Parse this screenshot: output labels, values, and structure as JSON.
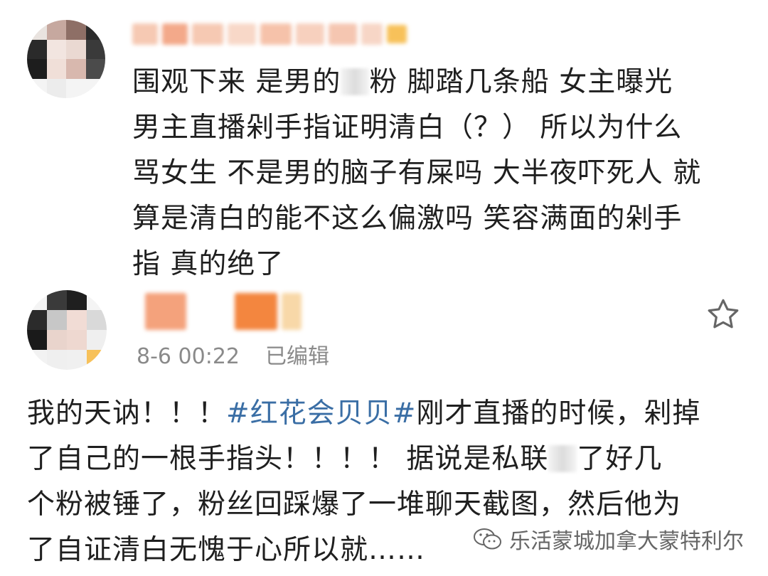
{
  "comments": [
    {
      "lines": [
        "围观下来 是男的",
        "粉 脚踏几条船 女主曝光",
        "男主直播剁手指证明清白（？） 所以为什么",
        "骂女生 不是男的脑子有屎吗 大半夜吓死人 就",
        "算是清白的能不这么偏激吗 笑容满面的剁手",
        "指 真的绝了"
      ]
    },
    {
      "timestamp": "8-6 00:22",
      "edited": "已编辑",
      "star_icon": "star-outline-icon",
      "lines": [
        "我的天讷！！！",
        "#红花会贝贝#",
        "刚才直播的时候，剁掉",
        "了自己的一根手指头！！！！ 据说是私联",
        "了好几",
        "个粉被锤了，粉丝回踩爆了一堆聊天截图，然后他为",
        "了自证清白无愧于心所以就……"
      ]
    }
  ],
  "watermark": {
    "text": "乐活蒙城加拿大蒙特利尔",
    "icon": "wechat-icon"
  },
  "colors": {
    "hashtag": "#3a6ea5",
    "text": "#1f1f1f",
    "meta": "#8a8a8a"
  }
}
